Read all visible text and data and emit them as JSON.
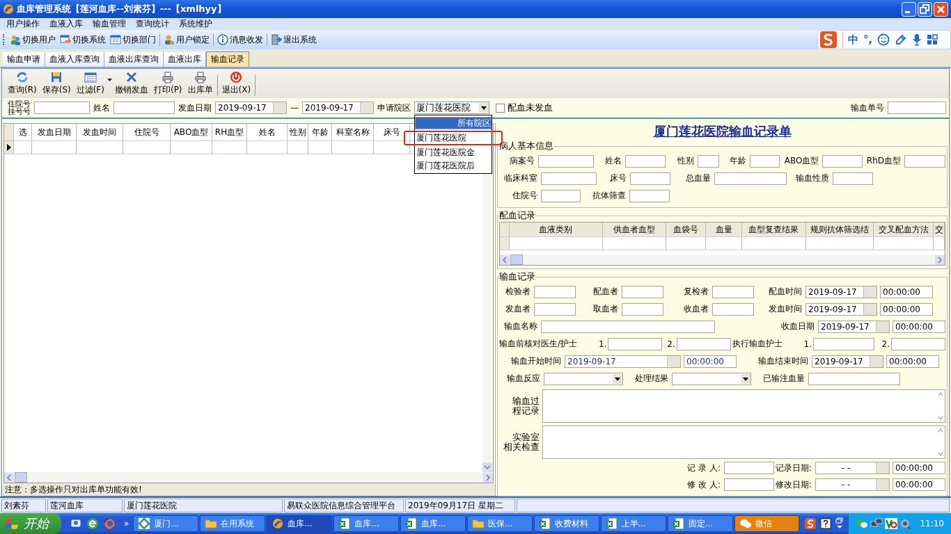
{
  "window": {
    "title": "血库管理系统【莲河血库--刘素芬】---【xmlhyy】"
  },
  "menu": [
    "用户操作",
    "血液入库",
    "输血管理",
    "查询统计",
    "系统维护"
  ],
  "toolbar": [
    "切换用户",
    "切换系统",
    "切换部门",
    "用户锁定",
    "消息收发",
    "退出系统"
  ],
  "ime_bar": {
    "mode": "中",
    "punct": "°,"
  },
  "tabs": [
    {
      "label": "输血申请",
      "selected": false
    },
    {
      "label": "血液入库查询",
      "selected": false
    },
    {
      "label": "血液出库查询",
      "selected": false
    },
    {
      "label": "血液出库",
      "selected": false
    },
    {
      "label": "输血记录",
      "selected": true
    }
  ],
  "actions": [
    "查询(R)",
    "保存(S)",
    "过滤(F)",
    "撤销发血",
    "打印(P)",
    "出库单",
    "退出(X)"
  ],
  "filter": {
    "id_label": [
      "住院号",
      "挂号号"
    ],
    "name_label": "姓名",
    "date_label": "发血日期",
    "date_from": "2019-09-17",
    "date_sep": "—",
    "date_to": "2019-09-17",
    "campus_label": "申请院区",
    "campus_value": "厦门莲花医院",
    "campus_options": [
      {
        "label": "所有院区",
        "selected": true,
        "annotated": false
      },
      {
        "label": "厦门莲花医院",
        "selected": false,
        "annotated": true
      },
      {
        "label": "厦门莲花医院金",
        "selected": false,
        "annotated": false
      },
      {
        "label": "厦门莲花医院后",
        "selected": false,
        "annotated": false
      }
    ],
    "unissued": {
      "label": "配血未发血",
      "checked": false
    },
    "order_label": "输血单号"
  },
  "grid": {
    "columns": [
      "选",
      "发血日期",
      "发血时间",
      "住院号",
      "ABO血型",
      "RH血型",
      "姓名",
      "性别",
      "年龄",
      "科室名称",
      "床号"
    ],
    "note": "注意：多选操作只对出库单功能有效!"
  },
  "record": {
    "title": "厦门莲花医院输血记录单",
    "patient": {
      "legend": "病人基本信息",
      "fields": [
        "病案号",
        "姓名",
        "性别",
        "年龄",
        "ABO血型",
        "RhD血型",
        "临床科室",
        "床号",
        "总血量",
        "输血性质",
        "住院号",
        "抗体筛查"
      ]
    },
    "crossmatch": {
      "legend": "配血记录",
      "columns": [
        "血液类别",
        "供血者血型",
        "血袋号",
        "血量",
        "血型复查结果",
        "规则抗体筛选结",
        "交叉配血方法",
        "交"
      ]
    },
    "transfusion": {
      "legend": "输血记录",
      "fields": [
        {
          "kind": "field",
          "label": "检验者"
        },
        {
          "kind": "field",
          "label": "配血者"
        },
        {
          "kind": "field",
          "label": "复检者"
        },
        {
          "kind": "datetime",
          "label": "配血时间",
          "date": "2019-09-17",
          "time": "00:00:00",
          "highlighted": false
        },
        {
          "kind": "field",
          "label": "发血者"
        },
        {
          "kind": "field",
          "label": "取血者"
        },
        {
          "kind": "field",
          "label": "收血者"
        },
        {
          "kind": "datetime",
          "label": "发血时间",
          "date": "2019-09-17",
          "time": "00:00:00",
          "highlighted": false
        },
        {
          "kind": "field",
          "label": "输血名称"
        },
        {
          "kind": "datetime",
          "label": "收血日期",
          "date": "2019-09-17",
          "time": "00:00:00",
          "highlighted": false
        },
        {
          "kind": "text",
          "label": "输血前核对医生/护士"
        },
        {
          "kind": "field",
          "label": "1."
        },
        {
          "kind": "field",
          "label": "2."
        },
        {
          "kind": "text",
          "label": "执行输血护士"
        },
        {
          "kind": "field",
          "label": "1."
        },
        {
          "kind": "field",
          "label": "2."
        },
        {
          "kind": "datetime",
          "label": "输血开始时间",
          "date": "2019-09-17",
          "time": "00:00:00",
          "highlighted": true
        },
        {
          "kind": "datetime",
          "label": "输血结束时间",
          "date": "2019-09-17",
          "time": "00:00:00",
          "highlighted": false
        },
        {
          "kind": "select",
          "label": "输血反应"
        },
        {
          "kind": "select",
          "label": "处理结果"
        },
        {
          "kind": "field",
          "label": "已输注血量"
        }
      ],
      "memos": [
        [
          "输血过",
          "程记录"
        ],
        [
          "实验室",
          "相关检查"
        ]
      ],
      "audit": [
        {
          "label": "记 录 人:",
          "date_label": "记录日期:",
          "date": "-  -",
          "time": "00:00:00"
        },
        {
          "label": "修 改 人:",
          "date_label": "修改日期:",
          "date": "-  -",
          "time": "00:00:00"
        }
      ]
    }
  },
  "status_bar": [
    "刘素芬",
    "莲河血库",
    "厦门莲花医院",
    "易联众医院信息综合管理平台",
    "2019年09月17日 星期二"
  ],
  "taskbar": {
    "start": "开始",
    "more": "»",
    "tasks": [
      {
        "label": "厦门...",
        "selected": false,
        "flashing": false
      },
      {
        "label": "在用系统",
        "selected": false,
        "flashing": false
      },
      {
        "label": "血库...",
        "selected": true,
        "flashing": false
      },
      {
        "label": "血库...",
        "selected": false,
        "flashing": false
      },
      {
        "label": "血库...",
        "selected": false,
        "flashing": false
      },
      {
        "label": "医保...",
        "selected": false,
        "flashing": false
      },
      {
        "label": "收费材料",
        "selected": false,
        "flashing": false
      },
      {
        "label": "上半...",
        "selected": false,
        "flashing": false
      },
      {
        "label": "固定...",
        "selected": false,
        "flashing": false
      },
      {
        "label": "微信",
        "selected": false,
        "flashing": true
      }
    ],
    "clock": "11:10"
  }
}
